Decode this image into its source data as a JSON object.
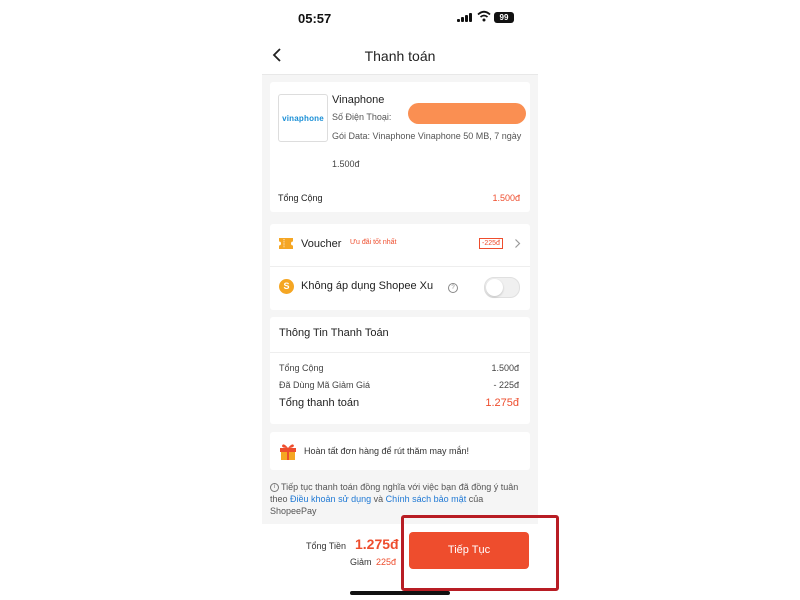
{
  "status_bar": {
    "time": "05:57",
    "battery": "99"
  },
  "header": {
    "title": "Thanh toán"
  },
  "product": {
    "logo_text": "vinaphone",
    "name": "Vinaphone",
    "phone_label": "Số Điện Thoại:",
    "description": "Gói Data: Vinaphone Vinaphone 50 MB, 7 ngày",
    "price": "1.500đ",
    "total_label": "Tổng Cộng",
    "total_value": "1.500đ"
  },
  "voucher": {
    "label": "Voucher",
    "badge": "Ưu đãi tốt nhất",
    "amount": "-225đ"
  },
  "shopee_xu": {
    "label": "Không áp dụng Shopee Xu",
    "enabled": false
  },
  "payment_info": {
    "title": "Thông Tin Thanh Toán",
    "rows": [
      {
        "label": "Tổng Cộng",
        "value": "1.500đ"
      },
      {
        "label": "Đã Dùng Mã Giảm Giá",
        "value": "- 225đ"
      }
    ],
    "grand_label": "Tổng thanh toán",
    "grand_value": "1.275đ"
  },
  "lucky": {
    "text": "Hoàn tất đơn hàng để rút thăm may mắn!"
  },
  "terms": {
    "prefix": "Tiếp tục thanh toán đồng nghĩa với việc bạn đã đồng ý tuân theo ",
    "link1": "Điều khoản sử dụng",
    "middle": " và ",
    "link2": "Chính sách bảo mật",
    "suffix": " của ShopeePay"
  },
  "bottom_bar": {
    "total_label": "Tổng Tiền",
    "total_value": "1.275đ",
    "discount_label": "Giảm",
    "discount_value": "225đ",
    "cta_label": "Tiếp Tục"
  },
  "colors": {
    "accent": "#ee4d2d",
    "link": "#1e78d4",
    "annotation": "#b81d24"
  }
}
